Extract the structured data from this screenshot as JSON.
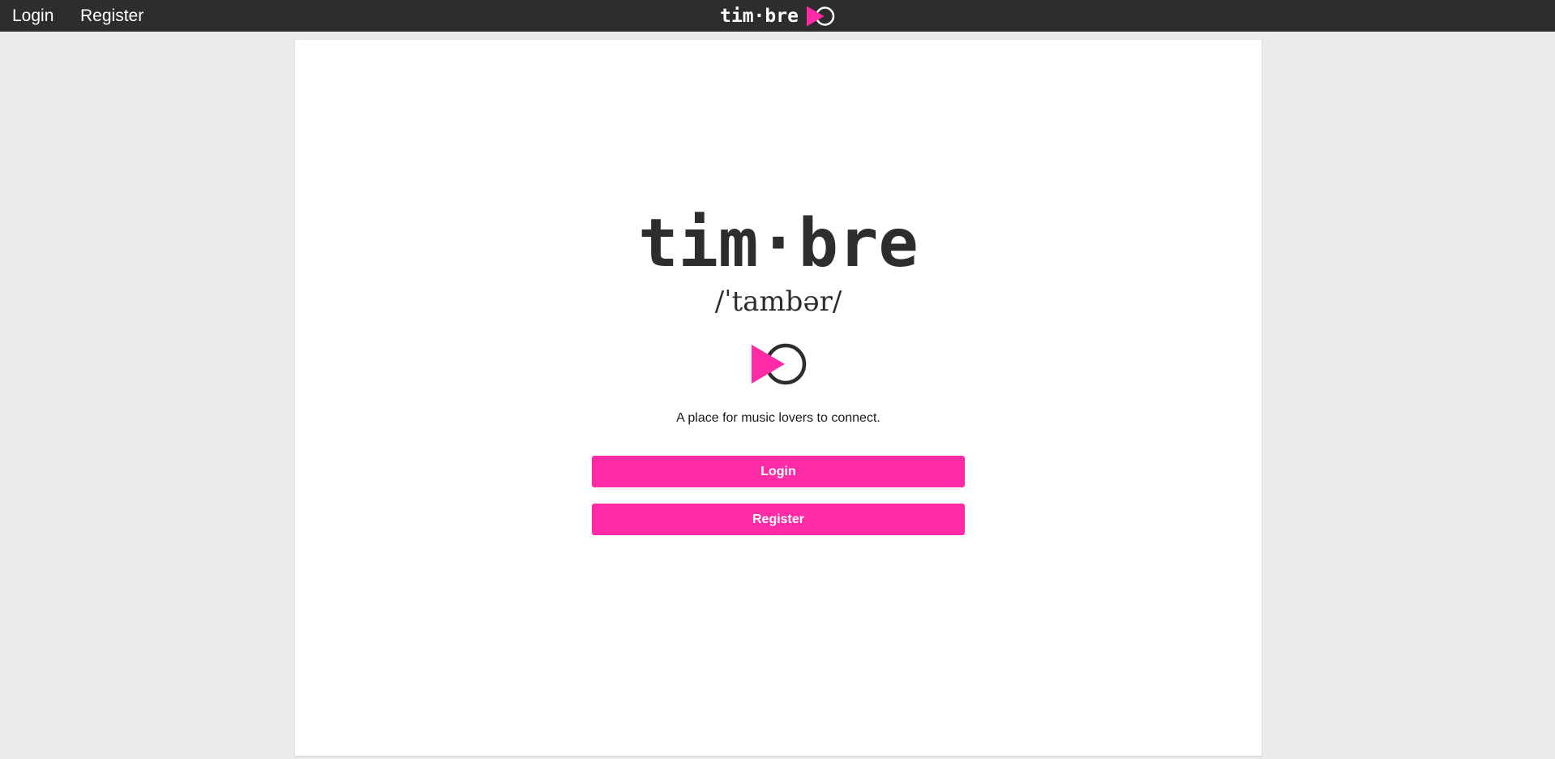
{
  "nav": {
    "login_label": "Login",
    "register_label": "Register",
    "brand_text": "tim·bre",
    "brand_logo_icon": "play-circle-logo-icon"
  },
  "hero": {
    "title": "tim·bre",
    "pronunciation": "/ˈtambər/",
    "logo_icon": "play-circle-logo-icon",
    "tagline": "A place for music lovers to connect."
  },
  "actions": {
    "login_label": "Login",
    "register_label": "Register"
  },
  "colors": {
    "accent": "#ff2aa5",
    "dark": "#2d2d2d",
    "background": "#ebebeb",
    "card": "#ffffff"
  }
}
